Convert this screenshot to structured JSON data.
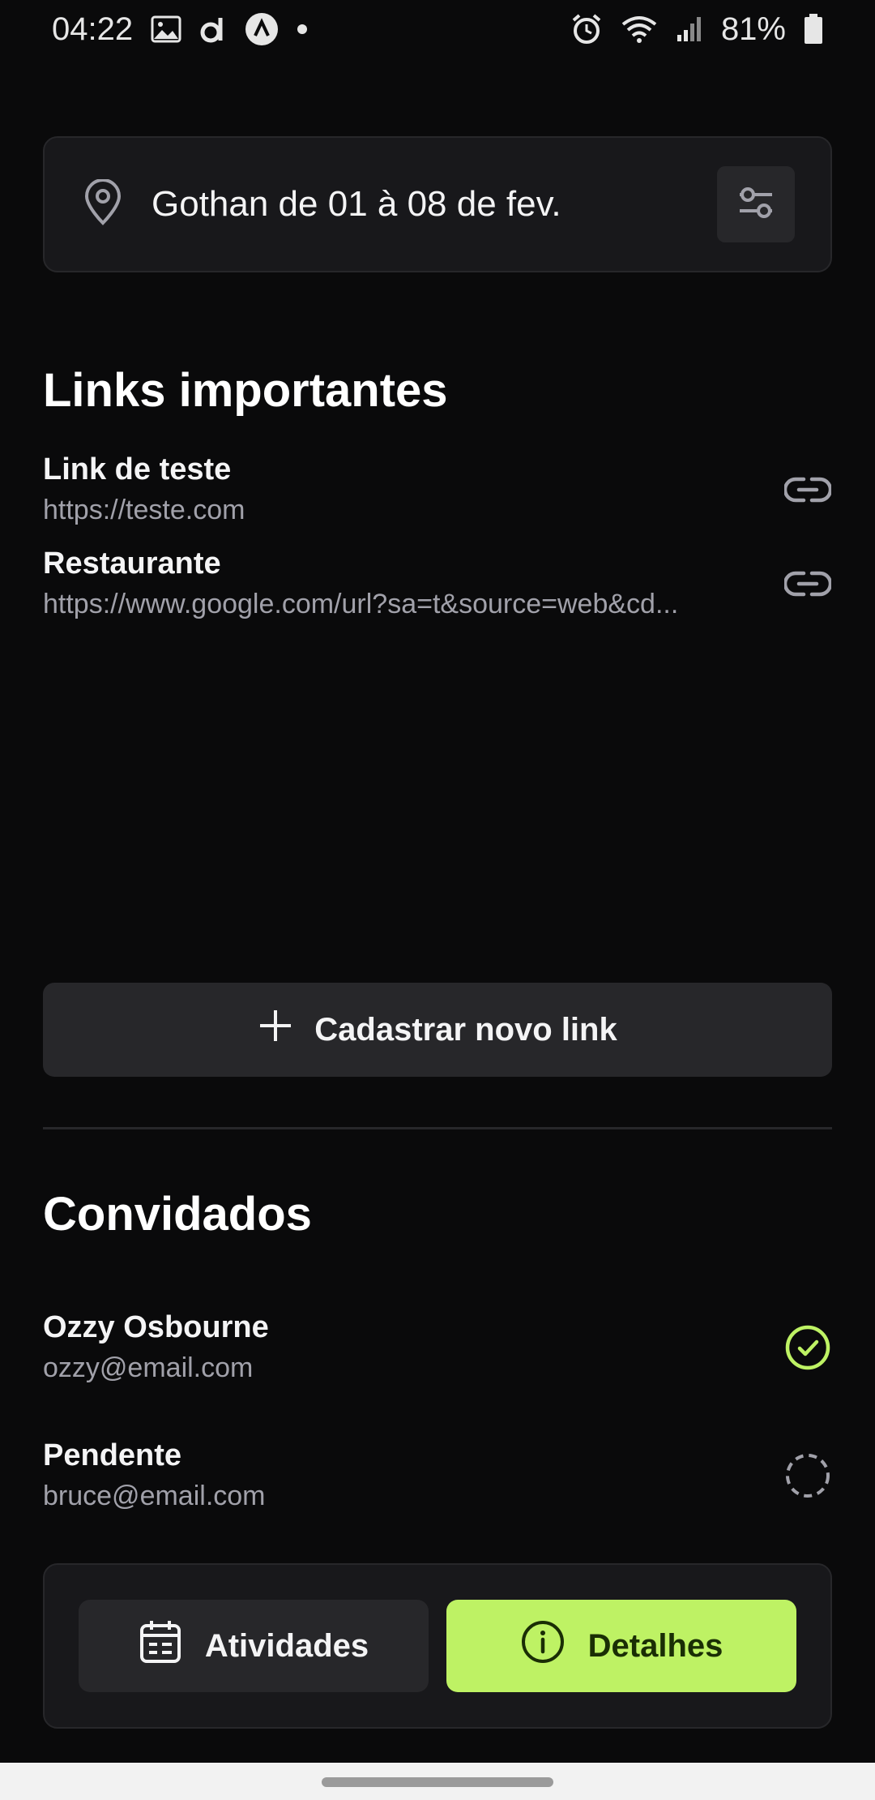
{
  "status_bar": {
    "time": "04:22",
    "battery": "81%",
    "icons_left": [
      "image-icon",
      "app-d-icon",
      "app-a-icon",
      "dot-icon"
    ],
    "icons_right": [
      "alarm-icon",
      "wifi-icon",
      "signal-icon",
      "battery-icon"
    ]
  },
  "trip": {
    "destination_text": "Gothan de 01 à 08 de fev.",
    "location_icon": "map-pin-icon",
    "settings_icon": "sliders-icon"
  },
  "links": {
    "title": "Links importantes",
    "items": [
      {
        "title": "Link de teste",
        "url": "https://teste.com"
      },
      {
        "title": "Restaurante",
        "url": "https://www.google.com/url?sa=t&source=web&cd..."
      }
    ],
    "add_button_label": "Cadastrar novo link"
  },
  "guests": {
    "title": "Convidados",
    "items": [
      {
        "name": "Ozzy Osbourne",
        "email": "ozzy@email.com",
        "status": "confirmed"
      },
      {
        "name": "Pendente",
        "email": "bruce@email.com",
        "status": "pending"
      }
    ]
  },
  "bottom_nav": {
    "activities_label": "Atividades",
    "details_label": "Detalhes",
    "active": "details"
  },
  "colors": {
    "background": "#0a0a0b",
    "surface": "#18181b",
    "surface_alt": "#27272a",
    "accent": "#bef264",
    "muted_text": "#a1a1aa"
  }
}
